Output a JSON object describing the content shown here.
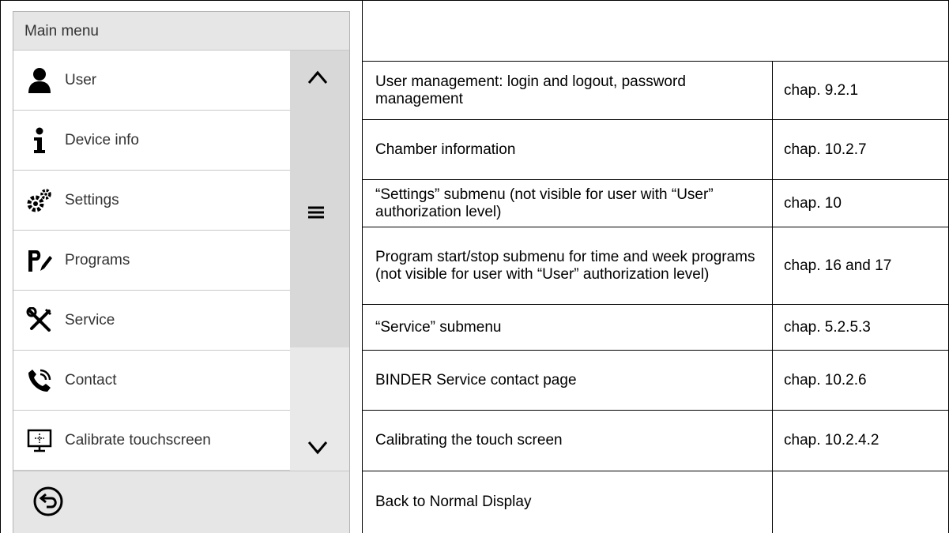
{
  "menu": {
    "header": "Main menu",
    "items": [
      {
        "label": "User",
        "icon": "user-icon"
      },
      {
        "label": "Device info",
        "icon": "info-icon"
      },
      {
        "label": "Settings",
        "icon": "settings-gears-icon"
      },
      {
        "label": "Programs",
        "icon": "programs-pencil-icon"
      },
      {
        "label": "Service",
        "icon": "service-tools-icon"
      },
      {
        "label": "Contact",
        "icon": "phone-icon"
      },
      {
        "label": "Calibrate touchscreen",
        "icon": "calibrate-screen-icon"
      }
    ],
    "back_icon": "back-arrow-icon"
  },
  "table": {
    "rows": [
      {
        "description": "User management: login and logout, password management",
        "chapter": "chap. 9.2.1"
      },
      {
        "description": "Chamber information",
        "chapter": "chap. 10.2.7"
      },
      {
        "description": "“Settings” submenu (not visible for user with “User” authorization level)",
        "chapter": "chap. 10"
      },
      {
        "description": "Program start/stop submenu for time and week programs (not visible for user with “User” authorization level)",
        "chapter": "chap. 16 and 17"
      },
      {
        "description": "“Service” submenu",
        "chapter": "chap. 5.2.5.3"
      },
      {
        "description": "BINDER Service contact page",
        "chapter": "chap. 10.2.6"
      },
      {
        "description": "Calibrating the touch screen",
        "chapter": "chap. 10.2.4.2"
      },
      {
        "description": "Back to Normal Display",
        "chapter": ""
      }
    ]
  },
  "colors": {
    "panel_gray": "#e6e6e6",
    "list_white": "#ffffff",
    "divider": "#c8c8c8",
    "text_dark": "#333333"
  }
}
